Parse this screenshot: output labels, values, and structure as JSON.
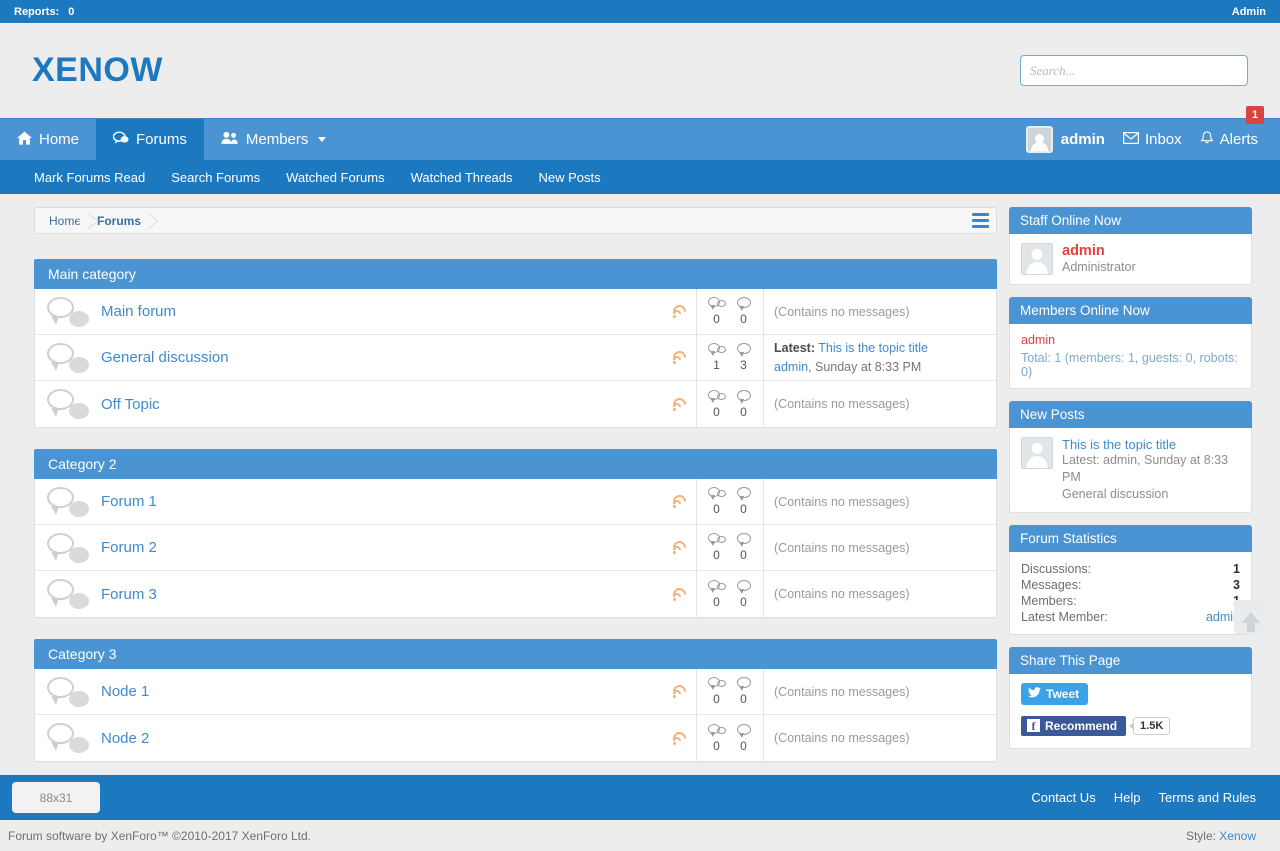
{
  "admin_strip": {
    "reports_label": "Reports:",
    "reports_count": "0",
    "admin_link": "Admin"
  },
  "header": {
    "logo": "XENOW",
    "search_placeholder": "Search...",
    "search_value": ""
  },
  "nav_primary": {
    "tabs": [
      {
        "label": "Home",
        "icon": "home-icon",
        "active": false
      },
      {
        "label": "Forums",
        "icon": "forums-icon",
        "active": true
      },
      {
        "label": "Members",
        "icon": "members-icon",
        "active": false,
        "caret": true
      }
    ],
    "user": "admin",
    "inbox": "Inbox",
    "alerts": "Alerts",
    "alert_count": "1"
  },
  "nav_secondary": [
    "Mark Forums Read",
    "Search Forums",
    "Watched Forums",
    "Watched Threads",
    "New Posts"
  ],
  "breadcrumb": [
    {
      "label": "Home",
      "current": false
    },
    {
      "label": "Forums",
      "current": true
    }
  ],
  "categories": [
    {
      "title": "Main category",
      "nodes": [
        {
          "title": "Main forum",
          "threads": "0",
          "messages": "0",
          "empty_text": "(Contains no messages)",
          "has_last": false
        },
        {
          "title": "General discussion",
          "threads": "1",
          "messages": "3",
          "has_last": true,
          "last_label": "Latest:",
          "last_title": "This is the topic title",
          "last_user": "admin",
          "last_time": ", Sunday at 8:33 PM"
        },
        {
          "title": "Off Topic",
          "threads": "0",
          "messages": "0",
          "empty_text": "(Contains no messages)",
          "has_last": false
        }
      ]
    },
    {
      "title": "Category 2",
      "nodes": [
        {
          "title": "Forum 1",
          "threads": "0",
          "messages": "0",
          "empty_text": "(Contains no messages)",
          "has_last": false
        },
        {
          "title": "Forum 2",
          "threads": "0",
          "messages": "0",
          "empty_text": "(Contains no messages)",
          "has_last": false
        },
        {
          "title": "Forum 3",
          "threads": "0",
          "messages": "0",
          "empty_text": "(Contains no messages)",
          "has_last": false
        }
      ]
    },
    {
      "title": "Category 3",
      "nodes": [
        {
          "title": "Node 1",
          "threads": "0",
          "messages": "0",
          "empty_text": "(Contains no messages)",
          "has_last": false
        },
        {
          "title": "Node 2",
          "threads": "0",
          "messages": "0",
          "empty_text": "(Contains no messages)",
          "has_last": false
        }
      ]
    }
  ],
  "sidebar": {
    "staff_online": {
      "title": "Staff Online Now",
      "name": "admin",
      "role": "Administrator"
    },
    "members_online": {
      "title": "Members Online Now",
      "name": "admin",
      "total": "Total: 1 (members: 1, guests: 0, robots: 0)"
    },
    "new_posts": {
      "title": "New Posts",
      "post_title": "This is the topic title",
      "meta": "Latest: admin, Sunday at 8:33 PM",
      "forum": "General discussion"
    },
    "forum_stats": {
      "title": "Forum Statistics",
      "rows": [
        {
          "key": "Discussions:",
          "value": "1",
          "link": false
        },
        {
          "key": "Messages:",
          "value": "3",
          "link": false
        },
        {
          "key": "Members:",
          "value": "1",
          "link": false
        },
        {
          "key": "Latest Member:",
          "value": "admin",
          "link": true
        }
      ]
    },
    "share": {
      "title": "Share This Page",
      "tweet": "Tweet",
      "recommend": "Recommend",
      "count": "1.5K"
    }
  },
  "footer": {
    "badge": "88x31",
    "links": [
      "Contact Us",
      "Help",
      "Terms and Rules"
    ],
    "copyright": "Forum software by XenForo™ ©2010-2017 XenForo Ltd.",
    "style_label": "Style:",
    "style_value": "Xenow"
  },
  "colors": {
    "primary": "#1c79c0",
    "secondary": "#4a94d4",
    "link": "#3f8bcc",
    "staff": "#e8403a",
    "alert": "#d9443f",
    "page_bg": "#ededed"
  }
}
